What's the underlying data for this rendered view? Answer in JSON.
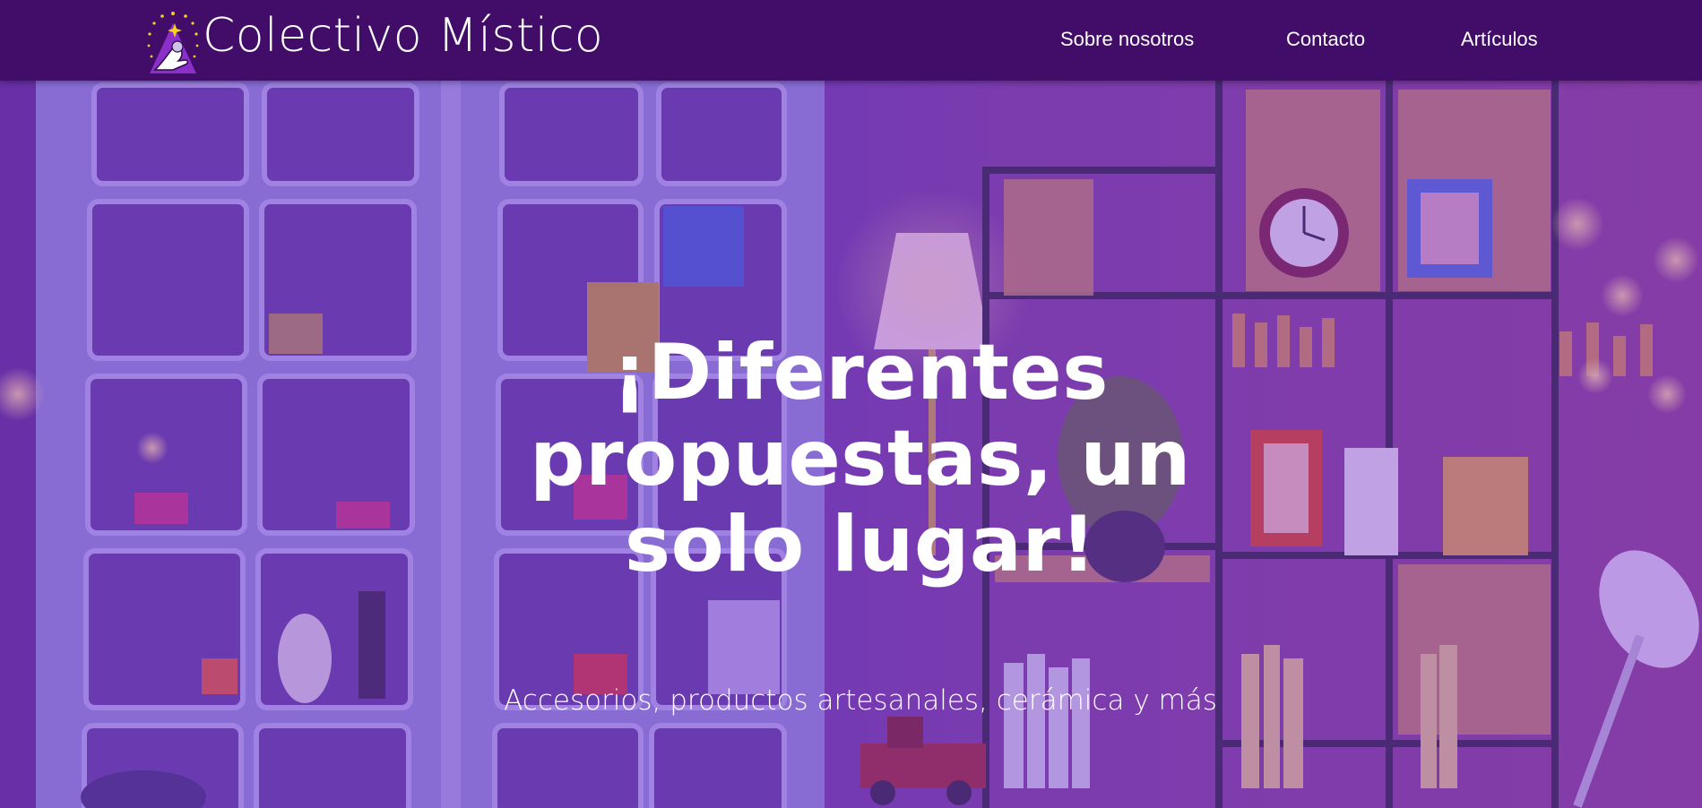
{
  "header": {
    "site_title": "Colectivo Místico",
    "logo_icon": "magic-hand-star-logo",
    "nav": [
      {
        "label": "Sobre nosotros"
      },
      {
        "label": "Contacto"
      },
      {
        "label": "Artículos"
      }
    ]
  },
  "hero": {
    "heading_lines": [
      "¡Diferentes",
      "propuestas, un",
      "solo lugar!"
    ],
    "subheading": "Accesorios, productos artesanales, cerámica y más"
  },
  "colors": {
    "header_bg": "#420c69",
    "hero_overlay": "#7e36cd",
    "text": "#ffffff",
    "logo_star": "#f5d21e"
  }
}
